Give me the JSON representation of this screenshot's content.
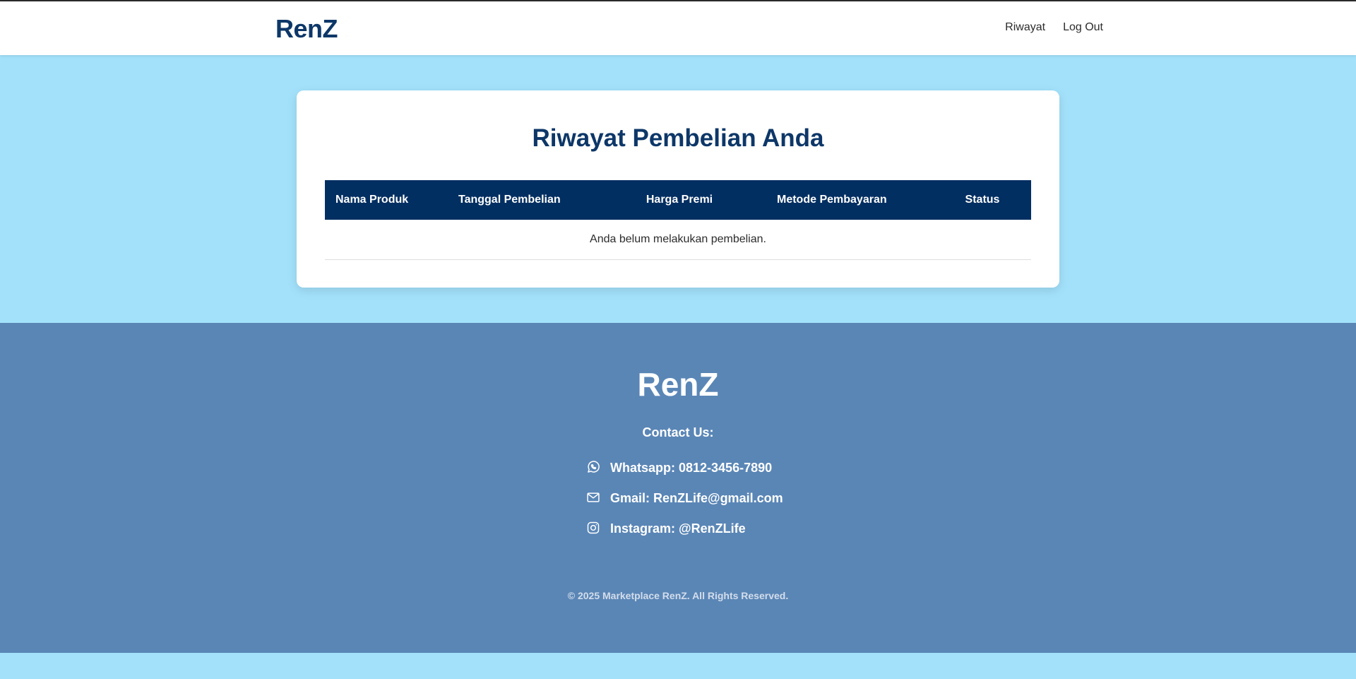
{
  "header": {
    "brand": "RenZ",
    "nav": {
      "riwayat": "Riwayat",
      "logout": "Log Out"
    }
  },
  "main": {
    "title": "Riwayat Pembelian Anda",
    "table": {
      "columns": [
        "Nama Produk",
        "Tanggal Pembelian",
        "Harga Premi",
        "Metode Pembayaran",
        "Status"
      ],
      "empty_message": "Anda belum melakukan pembelian."
    }
  },
  "footer": {
    "brand": "RenZ",
    "contact_heading": "Contact Us:",
    "contacts": [
      {
        "icon": "whatsapp-icon",
        "text": "Whatsapp: 0812-3456-7890"
      },
      {
        "icon": "mail-icon",
        "text": "Gmail: RenZLife@gmail.com"
      },
      {
        "icon": "instagram-icon",
        "text": "Instagram: @RenZLife"
      }
    ],
    "copyright": "© 2025 Marketplace RenZ. All Rights Reserved."
  },
  "colors": {
    "page_bg": "#a3e1fb",
    "brand": "#0d3768",
    "table_header": "#022f62",
    "footer_bg": "#5a86b6"
  }
}
